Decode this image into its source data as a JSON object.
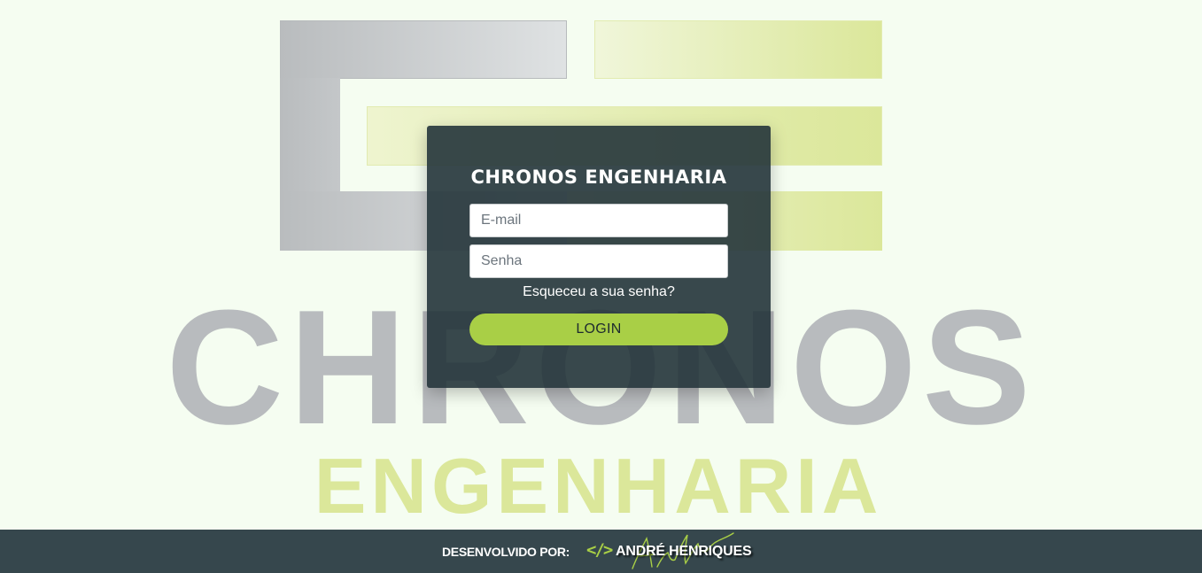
{
  "background_logo": {
    "word_main": "CHRONOS",
    "word_sub": "ENGENHARIA",
    "colors": {
      "gray": "#b8bbbe",
      "green": "#dbe79a",
      "page_bg": "#f5fdf1"
    }
  },
  "login": {
    "title": "CHRONOS ENGENHARIA",
    "email_placeholder": "E-mail",
    "password_placeholder": "Senha",
    "forgot_password": "Esqueceu a sua senha?",
    "login_button": "LOGIN",
    "colors": {
      "card_bg": "#24343a",
      "button_bg": "#a9cf46"
    }
  },
  "footer": {
    "developed_by_label": "DESENVOLVIDO POR:",
    "developer_icon": "code-icon",
    "developer_name": "ANDRÉ HENRIQUES",
    "colors": {
      "bg": "#36474d",
      "accent": "#a9cf46"
    }
  }
}
